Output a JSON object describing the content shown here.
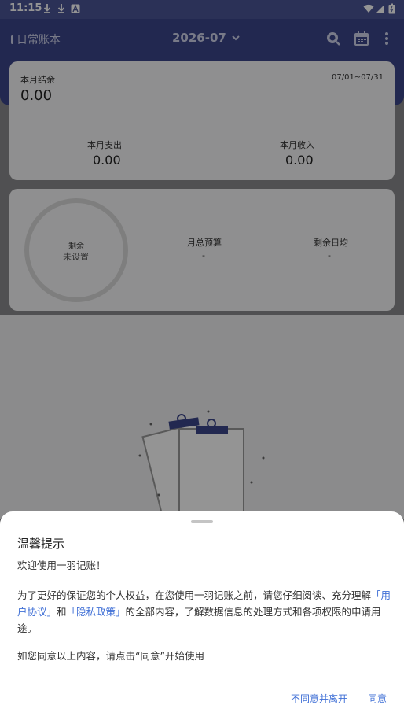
{
  "status_bar": {
    "time": "11:15"
  },
  "app_bar": {
    "book_name": "日常账本",
    "month": "2026-07"
  },
  "summary_card": {
    "balance_label": "本月结余",
    "balance_value": "0.00",
    "date_range": "07/01~07/31",
    "expense_label": "本月支出",
    "expense_value": "0.00",
    "income_label": "本月收入",
    "income_value": "0.00"
  },
  "budget_card": {
    "remaining_label": "剩余",
    "remaining_value": "未设置",
    "total_budget_label": "月总预算",
    "total_budget_value": "-",
    "daily_avg_label": "剩余日均",
    "daily_avg_value": "-"
  },
  "dialog": {
    "title": "温馨提示",
    "welcome": "欢迎使用一羽记账！",
    "para_prefix": "为了更好的保证您的个人权益，在您使用一羽记账之前，请您仔细阅读、充分理解",
    "user_agreement_link": "「用户协议」",
    "and_text": "和",
    "privacy_link": "「隐私政策」",
    "para_suffix": "的全部内容，了解数据信息的处理方式和各项权限的申请用途。",
    "consent_text": "如您同意以上内容，请点击“同意”开始使用",
    "disagree_button": "不同意并离开",
    "agree_button": "同意"
  },
  "icons": [
    "download-icon",
    "download-icon",
    "a-icon",
    "wifi-icon",
    "signal-icon",
    "battery-icon",
    "chevron-down-icon",
    "search-icon",
    "calendar-icon",
    "more-icon",
    "clipboard-illustration"
  ],
  "colors": {
    "primary": "#3b458a",
    "link": "#3f6fd6"
  }
}
